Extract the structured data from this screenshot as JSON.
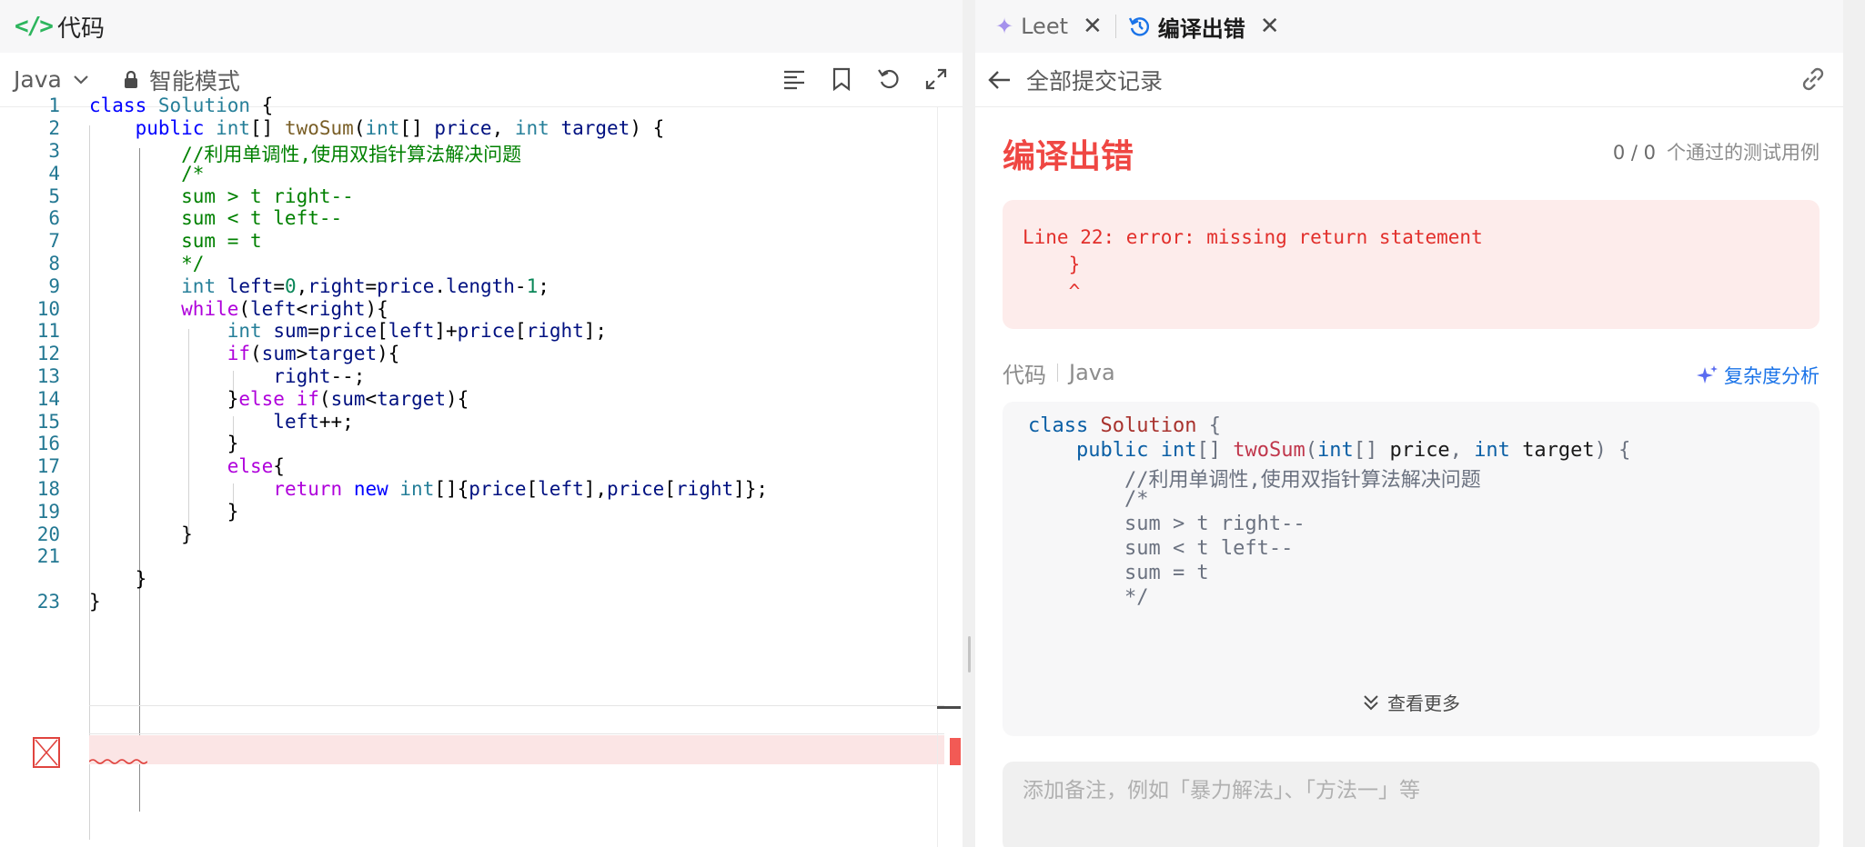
{
  "left": {
    "title": "代码",
    "language": "Java",
    "mode": "智能模式",
    "line_numbers": [
      "1",
      "2",
      "3",
      "4",
      "5",
      "6",
      "7",
      "8",
      "9",
      "10",
      "11",
      "12",
      "13",
      "14",
      "15",
      "16",
      "17",
      "18",
      "19",
      "20",
      "21",
      "",
      "23"
    ],
    "lines": [
      "class Solution {",
      "    public int[] twoSum(int[] price, int target) {",
      "        //利用单调性,使用双指针算法解决问题",
      "        /*",
      "        sum > t right--",
      "        sum < t left--",
      "        sum = t",
      "        */",
      "        int left=0,right=price.length-1;",
      "        while(left<right){",
      "            int sum=price[left]+price[right];",
      "            if(sum>target){",
      "                right--;",
      "            }else if(sum<target){",
      "                left++;",
      "            }",
      "            else{",
      "                return new int[]{price[left],price[right]};",
      "            }",
      "        }",
      "",
      "    }",
      "}"
    ]
  },
  "right": {
    "tabs": [
      {
        "label": "Leet",
        "active": false
      },
      {
        "label": "编译出错",
        "active": true
      }
    ],
    "back_label": "全部提交记录",
    "status": "编译出错",
    "tests_passed": "0 / 0",
    "tests_label": "个通过的测试用例",
    "error_message": "Line 22: error: missing return statement\n    }\n    ^",
    "code_label": "代码",
    "code_lang": "Java",
    "complexity_label": "复杂度分析",
    "preview_lines": [
      "class Solution {",
      "    public int[] twoSum(int[] price, int target) {",
      "        //利用单调性,使用双指针算法解决问题",
      "        /*",
      "        sum > t right--",
      "        sum < t left--",
      "        sum = t",
      "        */"
    ],
    "more_label": "查看更多",
    "note_placeholder": "添加备注，例如「暴力解法」、「方法一」等"
  },
  "colors": {
    "error_red": "#ef4743",
    "accent_blue": "#1a73e8",
    "code_green": "#2db55d"
  }
}
